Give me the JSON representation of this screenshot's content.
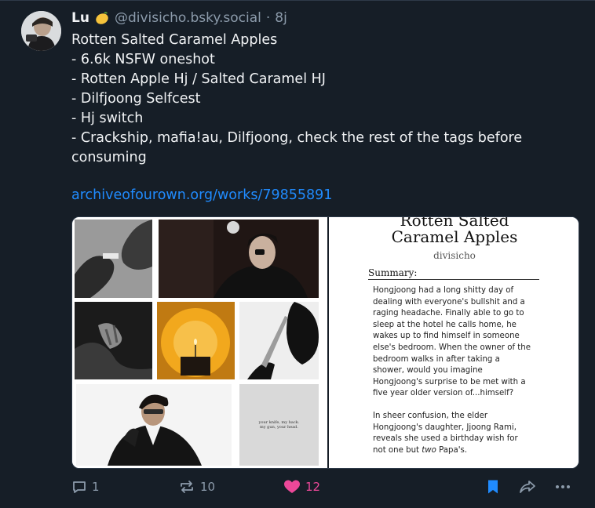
{
  "post": {
    "author": {
      "display_name": "Lu",
      "emoji": "lemon",
      "handle": "@divisicho.bsky.social",
      "separator": "·",
      "time_ago": "8j"
    },
    "text_lines": [
      "Rotten Salted Caramel Apples",
      "- 6.6k NSFW oneshot",
      "- Rotten Apple Hj / Salted Caramel HJ",
      "- Dilfjoong Selfcest",
      "- Hj switch",
      "- Crackship, mafia!au, Dilfjoong, check the rest of the tags before",
      "consuming"
    ],
    "link_text": "archiveofourown.org/works/79855891",
    "media": {
      "collage_caption": "your knife, my back.\nmy gun, your head.",
      "document": {
        "title_line1": "Rotten Salted",
        "title_line2": "Caramel Apples",
        "author": "divisicho",
        "summary_label": "Summary:",
        "paragraph1_lines": [
          "Hongjoong had a long shitty day of",
          "dealing with everyone's bullshit and a",
          "raging headache. Finally able to go to",
          "sleep at the hotel he calls home, he",
          "wakes up to find himself in someone",
          "else's bedroom. When the owner of the",
          "bedroom walks in after taking a",
          "shower, would you imagine",
          "Hongjoong's surprise to be met with a",
          "five year older version of...himself?"
        ],
        "paragraph2_lines": [
          "In sheer confusion, the elder",
          "Hongjoong's daughter, Jjoong Rami,",
          "reveals she used a birthday wish for",
          "not one but"
        ],
        "paragraph2_italic": "two",
        "paragraph2_end": "Papa's."
      }
    },
    "actions": {
      "reply_count": "1",
      "repost_count": "10",
      "like_count": "12",
      "icons": [
        "reply-icon",
        "repost-icon",
        "heart-icon",
        "bookmark-icon",
        "share-icon",
        "more-icon"
      ]
    },
    "colors": {
      "background": "#161e27",
      "link": "#208bfe",
      "like": "#ec4899",
      "muted": "#8c9bab",
      "bookmark": "#208bfe"
    }
  }
}
